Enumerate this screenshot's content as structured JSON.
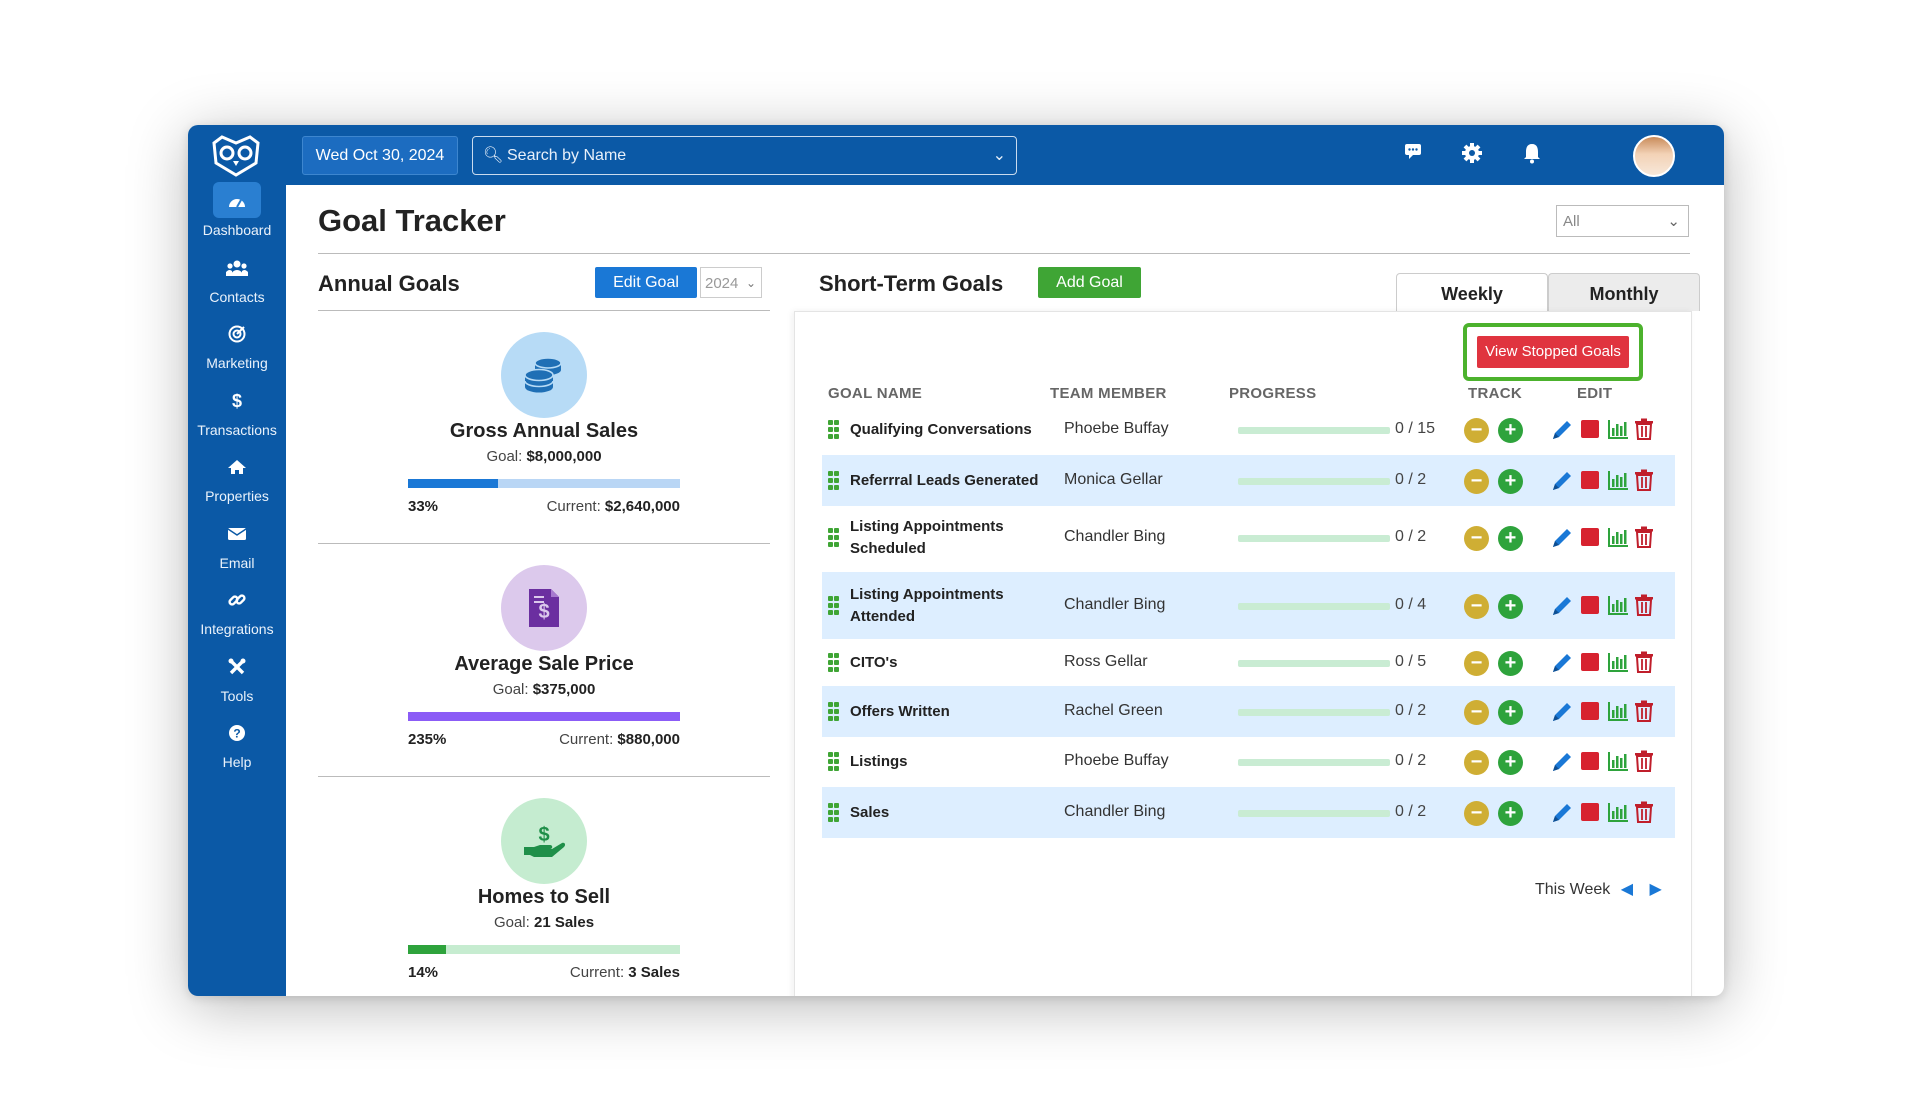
{
  "app": {
    "date": "Wed Oct 30, 2024",
    "search_placeholder": "Search by Name"
  },
  "sidebar": {
    "items": [
      {
        "label": "Dashboard",
        "icon": "gauge-icon",
        "active": true
      },
      {
        "label": "Contacts",
        "icon": "users-icon"
      },
      {
        "label": "Marketing",
        "icon": "target-icon"
      },
      {
        "label": "Transactions",
        "icon": "dollar-icon"
      },
      {
        "label": "Properties",
        "icon": "home-icon"
      },
      {
        "label": "Email",
        "icon": "envelope-icon"
      },
      {
        "label": "Integrations",
        "icon": "link-icon"
      },
      {
        "label": "Tools",
        "icon": "tools-icon"
      },
      {
        "label": "Help",
        "icon": "question-icon"
      }
    ]
  },
  "page": {
    "title": "Goal Tracker",
    "filter_value": "All"
  },
  "annual": {
    "title": "Annual Goals",
    "edit_label": "Edit Goal",
    "year": "2024",
    "cards": [
      {
        "title": "Gross Annual Sales",
        "goal_label": "Goal:",
        "goal": "$8,000,000",
        "percent": "33%",
        "current_label": "Current:",
        "current": "$2,640,000",
        "progress": 0.33,
        "color": "#1a78d6",
        "icon": "coins-icon"
      },
      {
        "title": "Average Sale Price",
        "goal_label": "Goal:",
        "goal": "$375,000",
        "percent": "235%",
        "current_label": "Current:",
        "current": "$880,000",
        "progress": 1.0,
        "color": "#8b5cf6",
        "icon": "invoice-icon"
      },
      {
        "title": "Homes to Sell",
        "goal_label": "Goal:",
        "goal": "21 Sales",
        "percent": "14%",
        "current_label": "Current:",
        "current": "3 Sales",
        "progress": 0.14,
        "color": "#2ea33c",
        "icon": "hand-dollar-icon"
      }
    ]
  },
  "short_term": {
    "title": "Short-Term Goals",
    "add_label": "Add Goal",
    "tabs": [
      "Weekly",
      "Monthly"
    ],
    "stopped_label": "View Stopped Goals",
    "columns": [
      "GOAL NAME",
      "TEAM MEMBER",
      "PROGRESS",
      "TRACK",
      "EDIT"
    ],
    "rows": [
      {
        "name": "Qualifying Conversations",
        "member": "Phoebe Buffay",
        "progress": "0 / 15"
      },
      {
        "name": "Referrral Leads Generated",
        "member": "Monica Gellar",
        "progress": "0 / 2"
      },
      {
        "name": "Listing Appointments Scheduled",
        "member": "Chandler Bing",
        "progress": "0 / 2"
      },
      {
        "name": "Listing Appointments Attended",
        "member": "Chandler Bing",
        "progress": "0 / 4"
      },
      {
        "name": "CITO's",
        "member": "Ross Gellar",
        "progress": "0 / 5"
      },
      {
        "name": "Offers Written",
        "member": "Rachel Green",
        "progress": "0 / 2"
      },
      {
        "name": "Listings",
        "member": "Phoebe Buffay",
        "progress": "0 / 2"
      },
      {
        "name": "Sales",
        "member": "Chandler Bing",
        "progress": "0 / 2"
      }
    ],
    "period_label": "This Week"
  }
}
